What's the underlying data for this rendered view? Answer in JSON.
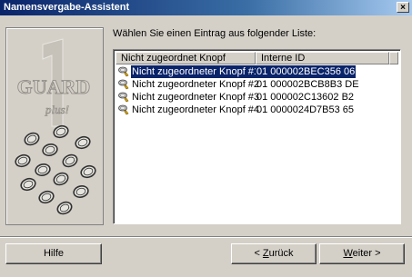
{
  "window": {
    "title": "Namensvergabe-Assistent",
    "close_glyph": "×"
  },
  "instruction": "Wählen Sie einen Eintrag aus folgender Liste:",
  "columns": [
    "Nicht zugeordnet Knopf",
    "Interne ID"
  ],
  "rows": [
    {
      "name": "Nicht zugeordneter Knopf #1",
      "id": "01 000002BEC356 06",
      "selected": true
    },
    {
      "name": "Nicht zugeordneter Knopf #2",
      "id": "01 000002BCB8B3 DE",
      "selected": false
    },
    {
      "name": "Nicht zugeordneter Knopf #3",
      "id": "01 000002C13602 B2",
      "selected": false
    },
    {
      "name": "Nicht zugeordneter Knopf #4",
      "id": "01 0000024D7B53 65",
      "selected": false
    }
  ],
  "logo": {
    "text1": "GUARD",
    "text2": "plus!"
  },
  "buttons": {
    "help": "Hilfe",
    "back": "< Zurück",
    "back_mnemonic": "Z",
    "back_rest": "urück",
    "back_prefix": "< ",
    "next": "Weiter >",
    "next_mnemonic": "W",
    "next_rest": "eiter >"
  }
}
